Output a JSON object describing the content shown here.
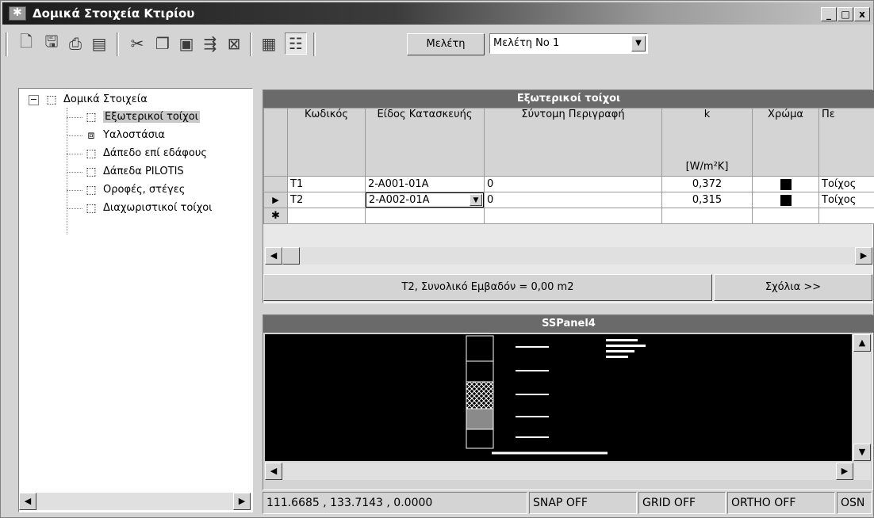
{
  "window": {
    "title": "Δομικά Στοιχεία Κτιρίου",
    "controls": {
      "minimize": "_",
      "maximize": "□",
      "close": "x"
    }
  },
  "toolbar": {
    "icons": [
      "new-document-icon",
      "save-icon",
      "print-icon",
      "print-preview-icon",
      "cut-icon",
      "copy-icon",
      "paste-icon",
      "export-icon",
      "excel-icon",
      "grid-view-icon",
      "details-view-icon"
    ],
    "melete_label": "Μελέτη",
    "study_select": {
      "value": "Μελέτη No 1"
    }
  },
  "tree": {
    "root": "Δομικά Στοιχεία",
    "items": [
      {
        "label": "Εξωτερικοί τοίχοι",
        "selected": true
      },
      {
        "label": "Υαλοστάσια"
      },
      {
        "label": "Δάπεδο επί εδάφους"
      },
      {
        "label": "Δάπεδα PILOTIS"
      },
      {
        "label": "Οροφές, στέγες"
      },
      {
        "label": "Διαχωριστικοί τοίχοι"
      }
    ]
  },
  "grid": {
    "caption": "Εξωτερικοί τοίχοι",
    "columns": {
      "code": "Κωδικός",
      "type": "Είδος Κατασκευής",
      "desc": "Σύντομη Περιγραφή",
      "k": "k",
      "k_unit": "[W/m²K]",
      "color": "Χρώμα",
      "extra": "Πε"
    },
    "rows": [
      {
        "code": "T1",
        "type": "2-A001-01A",
        "desc": "0",
        "k": "0,372",
        "extra": "Τοίχος"
      },
      {
        "code": "T2",
        "type": "2-A002-01A",
        "desc": "0",
        "k": "0,315",
        "extra": "Τοίχος"
      }
    ],
    "new_row_marker": "✱",
    "current_row_marker": "▶",
    "footer_text": "T2, Συνολικό Εμβαδόν = 0,00 m2",
    "comments_button": "Σχόλια >>"
  },
  "panel": {
    "caption": "SSPanel4"
  },
  "statusbar": {
    "coords": "111.6685 , 133.7143 , 0.0000",
    "snap": "SNAP OFF",
    "grid": "GRID OFF",
    "ortho": "ORTHO OFF",
    "osnap": "OSN"
  }
}
